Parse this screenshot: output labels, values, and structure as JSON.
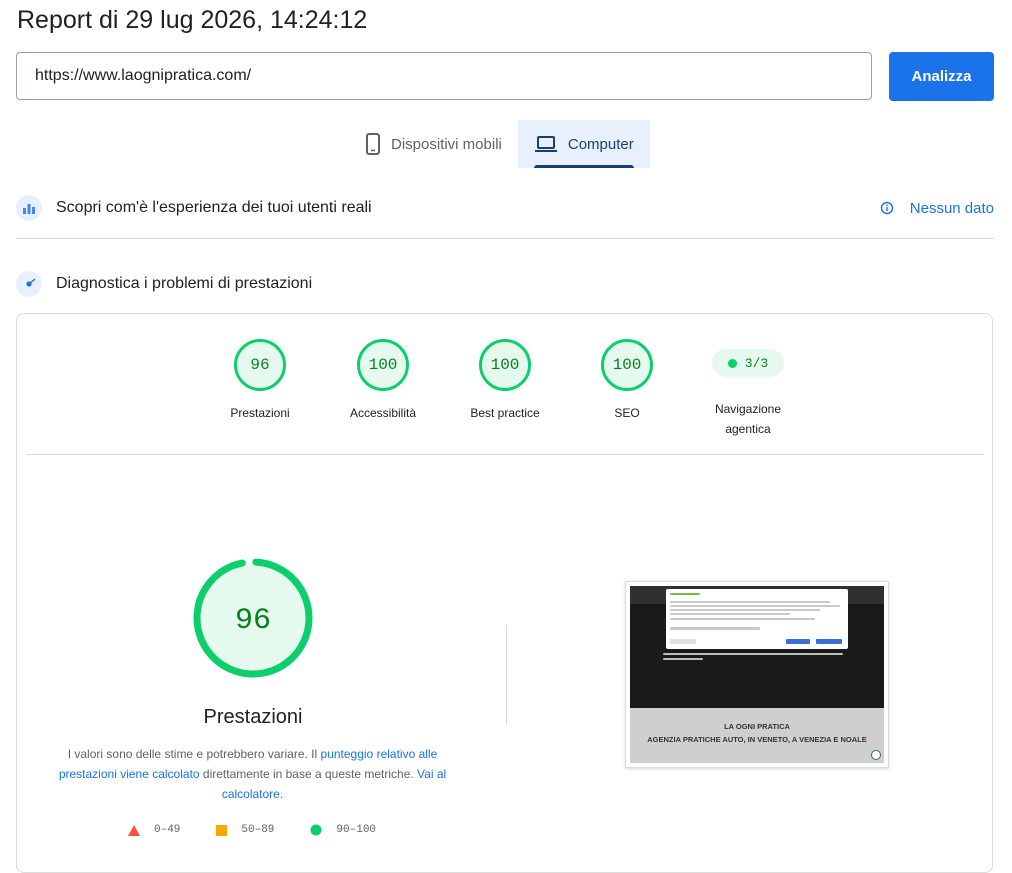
{
  "report": {
    "title": "Report di 29 lug 2026, 14:24:12"
  },
  "search": {
    "url": "https://www.laognipratica.com/",
    "button_label": "Analizza"
  },
  "tabs": [
    {
      "label": "Dispositivi mobili",
      "icon": "smartphone-icon",
      "active": false
    },
    {
      "label": "Computer",
      "icon": "laptop-icon",
      "active": true
    }
  ],
  "real_users": {
    "label": "Scopri com'è l'esperienza dei tuoi utenti reali",
    "status": "Nessun dato"
  },
  "diagnostics": {
    "label": "Diagnostica i problemi di prestazioni"
  },
  "categories": [
    {
      "score": "96",
      "label": "Prestazioni"
    },
    {
      "score": "100",
      "label": "Accessibilità"
    },
    {
      "score": "100",
      "label": "Best practice"
    },
    {
      "score": "100",
      "label": "SEO"
    }
  ],
  "agentic": {
    "score": "3/3",
    "label": "Navigazione agentica"
  },
  "performance": {
    "score": "96",
    "score_fraction": 0.96,
    "title": "Prestazioni",
    "desc_1": "I valori sono delle stime e potrebbero variare. Il ",
    "link_1": "punteggio relativo alle prestazioni viene calcolato",
    "desc_2": " direttamente in base a queste metriche. ",
    "link_2": "Vai al calcolatore."
  },
  "legend": [
    {
      "range": "0–49",
      "shape": "triangle",
      "color": "#ff4e42"
    },
    {
      "range": "50–89",
      "shape": "square",
      "color": "#ffa400"
    },
    {
      "range": "90–100",
      "shape": "circle",
      "color": "#0cce6b"
    }
  ],
  "screenshot": {
    "line1": "LA OGNI PRATICA",
    "line2": "AGENZIA PRATICHE AUTO, IN VENETO, A VENEZIA E NOALE"
  },
  "colors": {
    "accent": "#1a73e8",
    "pass": "#0cce6b",
    "pass_text": "#08801e",
    "pass_bg": "#e6f9ee"
  }
}
